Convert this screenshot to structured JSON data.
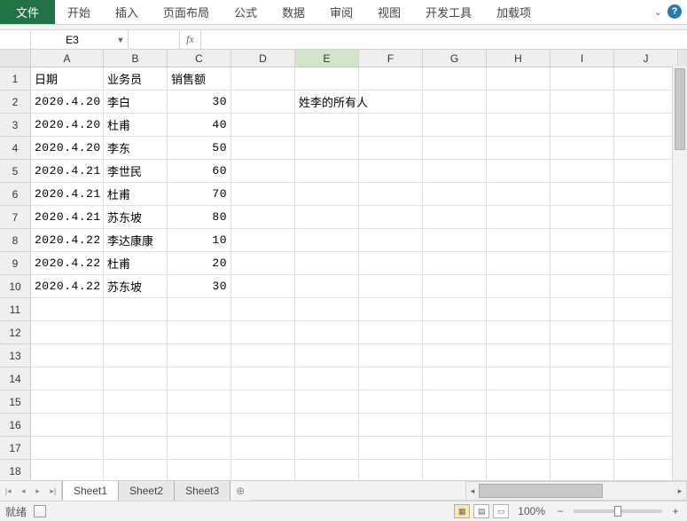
{
  "ribbon": {
    "tabs": [
      "文件",
      "开始",
      "插入",
      "页面布局",
      "公式",
      "数据",
      "审阅",
      "视图",
      "开发工具",
      "加载项"
    ],
    "help": "?"
  },
  "nameBox": {
    "value": "E3",
    "fx": "fx"
  },
  "columns": [
    "A",
    "B",
    "C",
    "D",
    "E",
    "F",
    "G",
    "H",
    "I",
    "J"
  ],
  "rowCount": 18,
  "selectedCol": "E",
  "headers": {
    "A": "日期",
    "B": "业务员",
    "C": "销售额"
  },
  "sideLabel": "姓李的所有人",
  "chart_data": {
    "type": "table",
    "columns": [
      "日期",
      "业务员",
      "销售额"
    ],
    "rows": [
      [
        "2020.4.20",
        "李白",
        30
      ],
      [
        "2020.4.20",
        "杜甫",
        40
      ],
      [
        "2020.4.20",
        "李东",
        50
      ],
      [
        "2020.4.21",
        "李世民",
        60
      ],
      [
        "2020.4.21",
        "杜甫",
        70
      ],
      [
        "2020.4.21",
        "苏东坡",
        80
      ],
      [
        "2020.4.22",
        "李达康康",
        10
      ],
      [
        "2020.4.22",
        "杜甫",
        20
      ],
      [
        "2020.4.22",
        "苏东坡",
        30
      ]
    ]
  },
  "sheets": {
    "tabs": [
      "Sheet1",
      "Sheet2",
      "Sheet3"
    ],
    "active": 0
  },
  "status": {
    "ready": "就绪",
    "zoom": "100%"
  }
}
